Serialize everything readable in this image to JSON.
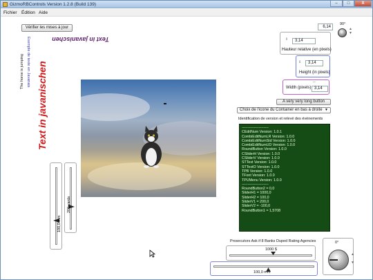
{
  "window": {
    "title": "GizmoRBControls Version 1.2.8 (Build 139)",
    "minimize": "–",
    "maximize": "□",
    "close": "X"
  },
  "menu": [
    "Fichier",
    "Édition",
    "Aide"
  ],
  "check_updates_label": "Vérifier les mises à jour",
  "top_value": "6,14",
  "angle_top": "90°",
  "relative_height": {
    "value": "3,14",
    "label": "Hauteur relative (en pixels)"
  },
  "height": {
    "value": "3,14",
    "label": "Height (in pixels)"
  },
  "width": {
    "value": "3,14",
    "label": "Width (pixels)"
  },
  "long_button": "A very very long button",
  "icon_select": "Choix de l'icone du Container en bas à droite",
  "events_label": "Identification de version et relevé des évènements",
  "log_lines": [
    "----------------------",
    "CEditNum Version: 1.0.1",
    "CombiEditNumLR Version: 1.0.0",
    "CombiEditNumStd Version: 1.0.0",
    "CombiEditNumUD Version: 1.0.0",
    "RoundButton Version: 1.0.0",
    "CSliderH Version: 1.0.0",
    "CSliderV Version: 1.0.0",
    "STText Version: 1.0.0",
    "STTextO Version: 1.0.0",
    "TPB Version: 1.0.0",
    "TFont Version: 1.0.0",
    "TPUMenu Version: 1.0.0",
    "----------------------",
    "RoundButton2 = 0,0",
    "SliderH1 = 1000,0",
    "SliderH2 = 100,0",
    "SliderV1 = 200,0",
    "SliderV2 = -100,0",
    "RoundButton1 = 1,5708"
  ],
  "vertical_texts": {
    "horse": "The horse is jumping",
    "example": "Exemple de texte en Javanais",
    "javanese_big": "Text in javanischen",
    "javanese_upside": "Text in javanischen"
  },
  "slider_v1_label": "100,0 mm",
  "slider_v2_label": "200 yards",
  "prosecutors": "Prosecutors Ask if 8 Banks Duped Rating Agencies",
  "slider_h1_label": "1000 $",
  "slider_h2_label": "100,0 mm",
  "angle_bottom": "0°",
  "colors": {
    "log_bg": "#154c15",
    "red_text": "#d01818",
    "blue_text": "#3a3ab0",
    "purple_text": "#5b1f6b"
  }
}
